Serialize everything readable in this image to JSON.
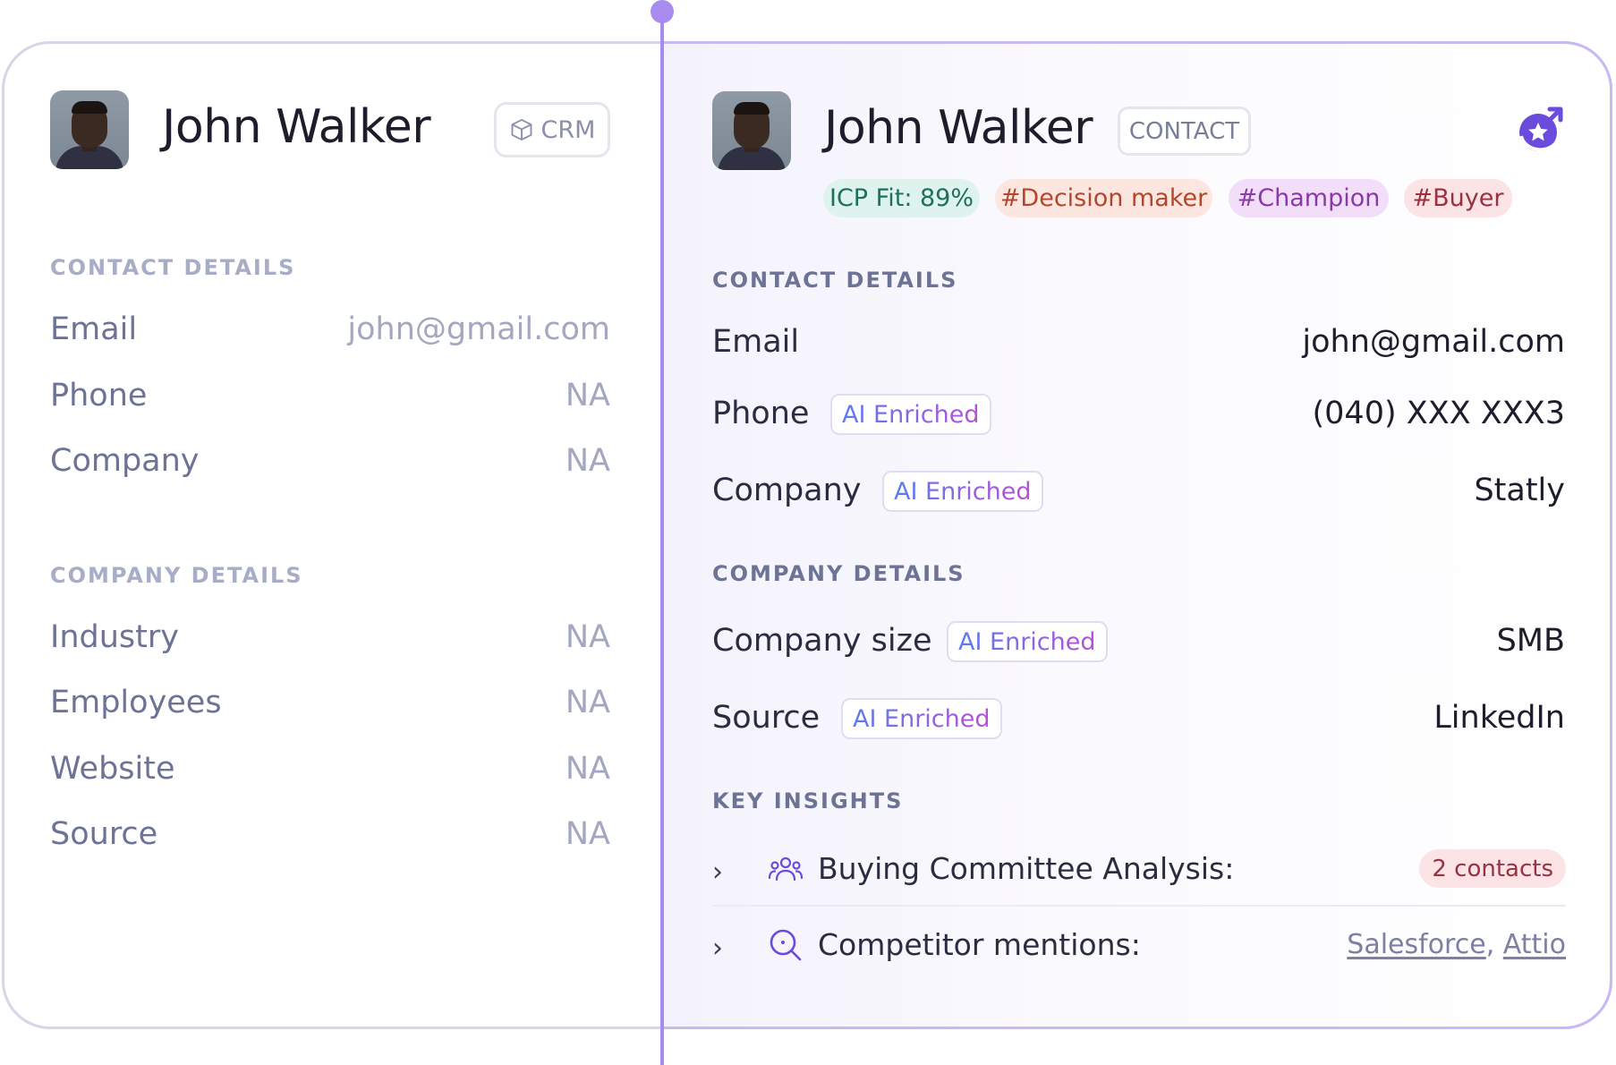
{
  "left": {
    "name": "John Walker",
    "badge": "CRM",
    "contact_details": {
      "title": "CONTACT DETAILS",
      "rows": [
        {
          "label": "Email",
          "value": "john@gmail.com"
        },
        {
          "label": "Phone",
          "value": "NA"
        },
        {
          "label": "Company",
          "value": "NA"
        }
      ]
    },
    "company_details": {
      "title": "COMPANY DETAILS",
      "rows": [
        {
          "label": "Industry",
          "value": "NA"
        },
        {
          "label": "Employees",
          "value": "NA"
        },
        {
          "label": "Website",
          "value": "NA"
        },
        {
          "label": "Source",
          "value": "NA"
        }
      ]
    }
  },
  "right": {
    "name": "John Walker",
    "badge": "CONTACT",
    "tags": [
      {
        "text": "ICP Fit: 89%",
        "bg": "#dff3ee",
        "color": "#1e6f5c"
      },
      {
        "text": "#Decision maker",
        "bg": "#fde6df",
        "color": "#b3472c"
      },
      {
        "text": "#Champion",
        "bg": "#f3defa",
        "color": "#8a3aa8"
      },
      {
        "text": "#Buyer",
        "bg": "#fbe3e6",
        "color": "#9a3140"
      }
    ],
    "ai_badge": "AI Enriched",
    "contact_details": {
      "title": "CONTACT DETAILS",
      "rows": [
        {
          "label": "Email",
          "value": "john@gmail.com",
          "ai": false
        },
        {
          "label": "Phone",
          "value": "(040) XXX XXX3",
          "ai": true
        },
        {
          "label": "Company",
          "value": "Statly",
          "ai": true
        }
      ]
    },
    "company_details": {
      "title": "COMPANY DETAILS",
      "rows": [
        {
          "label": "Company size",
          "value": "SMB",
          "ai": true
        },
        {
          "label": "Source",
          "value": "LinkedIn",
          "ai": true
        }
      ]
    },
    "key_insights": {
      "title": "KEY INSIGHTS",
      "buying_committee": {
        "label": "Buying Committee Analysis:",
        "count": "2 contacts",
        "icon": "users-icon"
      },
      "competitors": {
        "label": "Competitor mentions:",
        "links": [
          "Salesforce",
          "Attio"
        ],
        "separator": ",",
        "icon": "search-icon"
      }
    }
  },
  "colors": {
    "accent": "#a78bef",
    "brand": "#6a4bdc"
  }
}
